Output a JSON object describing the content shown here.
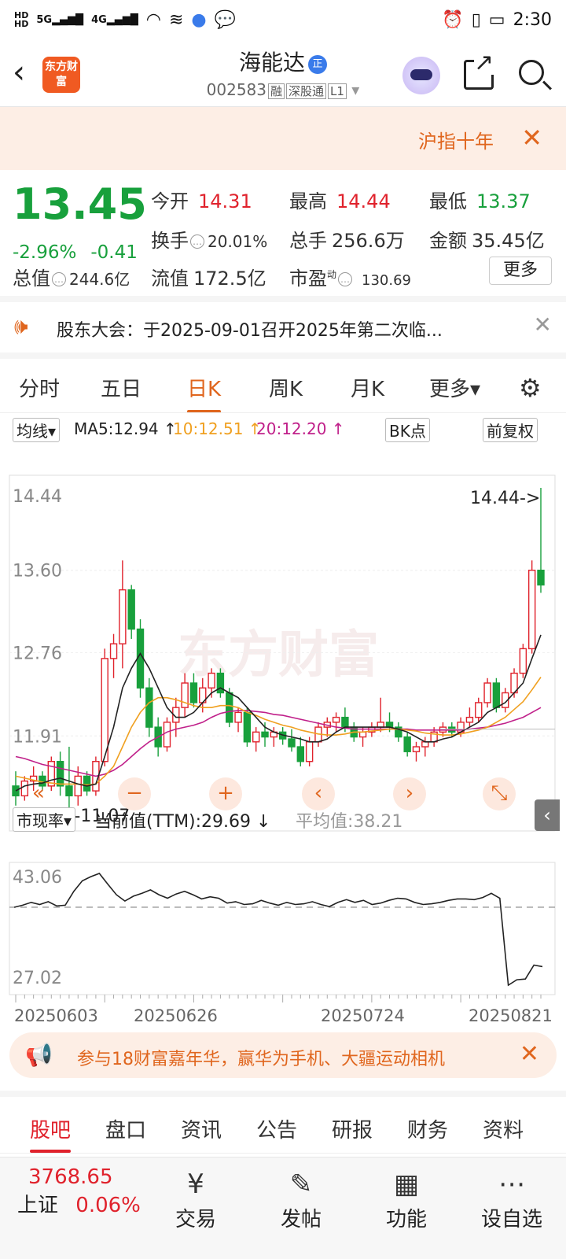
{
  "status": {
    "left_icons": [
      "HD1",
      "HD2",
      "5G-signal",
      "4G-signal",
      "wifi",
      "nfc",
      "browser",
      "chat"
    ],
    "signal1": "5G",
    "signal2": "4G",
    "time": "2:30"
  },
  "header": {
    "logo": "东方财富",
    "title": "海能达",
    "title_badge": "正",
    "code": "002583",
    "tags": [
      "融",
      "深股通",
      "L1"
    ]
  },
  "banner": {
    "text": "沪指十年"
  },
  "quote": {
    "price": "13.45",
    "change_pct": "-2.96%",
    "change": "-0.41",
    "open_label": "今开",
    "open": "14.31",
    "high_label": "最高",
    "high": "14.44",
    "low_label": "最低",
    "low": "13.37",
    "turnover_label": "换手",
    "turnover": "20.01%",
    "volume_label": "总手",
    "volume": "256.6万",
    "amount_label": "金额",
    "amount": "35.45亿",
    "mktcap_label": "总值",
    "mktcap": "244.6亿",
    "float_label": "流值",
    "float_cap": "172.5亿",
    "pe_label": "市盈",
    "pe_sup": "动",
    "pe": "130.69",
    "more": "更多"
  },
  "notice": {
    "text": "股东大会：于2025-09-01召开2025年第二次临..."
  },
  "ktabs": [
    "分时",
    "五日",
    "日K",
    "周K",
    "月K",
    "更多"
  ],
  "ktab_active": 2,
  "legend": {
    "ma_select": "均线",
    "ma5": "MA5:12.94 ↑",
    "ma10": "10:12.51 ↑",
    "ma20": "20:12.20 ↑",
    "bs_point": "BK点",
    "adjust": "前复权",
    "colors": {
      "ma5": "#222222",
      "ma10": "#f0a020",
      "ma20": "#c0208a",
      "up": "#e0222c",
      "down": "#18a03c"
    }
  },
  "chart_data": [
    {
      "type": "candlestick",
      "y_ticks": [
        "14.44",
        "13.60",
        "12.76",
        "11.91",
        "11.07"
      ],
      "ylim": [
        11.07,
        14.44
      ],
      "max_label": "14.44->",
      "min_label": "<-11.07",
      "x_ticks": [
        "20250603",
        "20250626",
        "20250724",
        "20250821"
      ],
      "watermark": "东方财富",
      "candles": [
        [
          11.4,
          11.55,
          11.2,
          11.3
        ],
        [
          11.3,
          11.5,
          11.25,
          11.45
        ],
        [
          11.45,
          11.6,
          11.35,
          11.5
        ],
        [
          11.5,
          11.55,
          11.35,
          11.4
        ],
        [
          11.4,
          11.7,
          11.35,
          11.65
        ],
        [
          11.65,
          11.75,
          11.3,
          11.4
        ],
        [
          11.4,
          11.8,
          11.15,
          11.3
        ],
        [
          11.3,
          11.6,
          11.2,
          11.5
        ],
        [
          11.5,
          11.55,
          11.3,
          11.35
        ],
        [
          11.35,
          11.7,
          11.3,
          11.65
        ],
        [
          11.65,
          12.8,
          11.6,
          12.7
        ],
        [
          12.7,
          12.95,
          12.5,
          12.85
        ],
        [
          12.85,
          13.7,
          12.6,
          13.4
        ],
        [
          13.4,
          13.45,
          12.9,
          13.0
        ],
        [
          13.0,
          13.1,
          12.3,
          12.4
        ],
        [
          12.4,
          12.5,
          11.9,
          12.0
        ],
        [
          12.0,
          12.1,
          11.7,
          11.8
        ],
        [
          11.8,
          12.1,
          11.75,
          12.05
        ],
        [
          12.05,
          12.3,
          11.9,
          12.2
        ],
        [
          12.2,
          12.55,
          12.1,
          12.45
        ],
        [
          12.45,
          12.55,
          12.2,
          12.25
        ],
        [
          12.25,
          12.5,
          12.15,
          12.4
        ],
        [
          12.4,
          12.6,
          12.3,
          12.55
        ],
        [
          12.55,
          12.6,
          12.3,
          12.35
        ],
        [
          12.35,
          12.4,
          12.0,
          12.05
        ],
        [
          12.05,
          12.2,
          11.95,
          12.15
        ],
        [
          12.15,
          12.2,
          11.8,
          11.85
        ],
        [
          11.85,
          12.0,
          11.75,
          11.95
        ],
        [
          11.95,
          12.05,
          11.8,
          11.9
        ],
        [
          11.9,
          12.0,
          11.8,
          11.95
        ],
        [
          11.95,
          12.0,
          11.82,
          11.88
        ],
        [
          11.88,
          11.98,
          11.75,
          11.8
        ],
        [
          11.8,
          11.9,
          11.6,
          11.65
        ],
        [
          11.65,
          11.9,
          11.6,
          11.85
        ],
        [
          11.85,
          12.05,
          11.8,
          12.0
        ],
        [
          12.0,
          12.1,
          11.9,
          12.05
        ],
        [
          12.05,
          12.15,
          11.95,
          12.1
        ],
        [
          12.1,
          12.2,
          11.95,
          12.0
        ],
        [
          12.0,
          12.05,
          11.85,
          11.9
        ],
        [
          11.9,
          12.0,
          11.8,
          11.95
        ],
        [
          11.95,
          12.05,
          11.9,
          12.0
        ],
        [
          12.0,
          12.3,
          11.95,
          12.05
        ],
        [
          12.05,
          12.15,
          11.95,
          12.0
        ],
        [
          12.0,
          12.05,
          11.85,
          11.9
        ],
        [
          11.9,
          11.95,
          11.7,
          11.75
        ],
        [
          11.75,
          11.85,
          11.65,
          11.8
        ],
        [
          11.8,
          11.9,
          11.7,
          11.85
        ],
        [
          11.85,
          12.0,
          11.8,
          11.95
        ],
        [
          11.95,
          12.05,
          11.9,
          12.0
        ],
        [
          12.0,
          12.05,
          11.9,
          11.95
        ],
        [
          11.95,
          12.1,
          11.9,
          12.05
        ],
        [
          12.05,
          12.2,
          12.0,
          12.1
        ],
        [
          12.1,
          12.3,
          12.05,
          12.25
        ],
        [
          12.25,
          12.5,
          12.2,
          12.45
        ],
        [
          12.45,
          12.5,
          12.15,
          12.2
        ],
        [
          12.2,
          12.4,
          12.15,
          12.35
        ],
        [
          12.35,
          12.6,
          12.3,
          12.55
        ],
        [
          12.55,
          12.85,
          12.5,
          12.8
        ],
        [
          12.8,
          13.7,
          12.75,
          13.6
        ],
        [
          13.6,
          14.44,
          13.37,
          13.45
        ]
      ],
      "ma5": [
        11.35,
        11.4,
        11.42,
        11.43,
        11.46,
        11.48,
        11.45,
        11.42,
        11.4,
        11.42,
        11.7,
        12.0,
        12.4,
        12.6,
        12.75,
        12.6,
        12.4,
        12.2,
        12.1,
        12.1,
        12.15,
        12.25,
        12.35,
        12.4,
        12.35,
        12.3,
        12.2,
        12.1,
        12.0,
        11.95,
        11.92,
        11.9,
        11.88,
        11.85,
        11.85,
        11.88,
        11.95,
        12.0,
        12.0,
        12.0,
        12.0,
        12.0,
        12.0,
        11.98,
        11.95,
        11.9,
        11.85,
        11.85,
        11.88,
        11.9,
        11.95,
        12.0,
        12.05,
        12.15,
        12.2,
        12.25,
        12.35,
        12.45,
        12.7,
        12.94
      ],
      "ma10": [
        11.5,
        11.48,
        11.46,
        11.44,
        11.43,
        11.42,
        11.42,
        11.42,
        11.41,
        11.42,
        11.5,
        11.6,
        11.8,
        12.0,
        12.15,
        12.25,
        12.3,
        12.3,
        12.28,
        12.25,
        12.22,
        12.2,
        12.2,
        12.22,
        12.22,
        12.2,
        12.15,
        12.12,
        12.08,
        12.05,
        12.02,
        12.0,
        11.97,
        11.95,
        11.93,
        11.92,
        11.92,
        11.93,
        11.95,
        11.95,
        11.96,
        11.97,
        11.98,
        11.98,
        11.97,
        11.96,
        11.94,
        11.93,
        11.92,
        11.92,
        11.93,
        11.95,
        11.97,
        12.0,
        12.05,
        12.1,
        12.18,
        12.26,
        12.38,
        12.51
      ],
      "ma20": [
        11.7,
        11.68,
        11.65,
        11.62,
        11.6,
        11.58,
        11.56,
        11.54,
        11.52,
        11.5,
        11.52,
        11.56,
        11.62,
        11.7,
        11.78,
        11.85,
        11.9,
        11.95,
        11.98,
        12.0,
        12.02,
        12.05,
        12.1,
        12.14,
        12.16,
        12.17,
        12.17,
        12.16,
        12.15,
        12.13,
        12.12,
        12.1,
        12.08,
        12.06,
        12.04,
        12.02,
        12.0,
        11.99,
        11.98,
        11.98,
        11.98,
        11.98,
        11.98,
        11.98,
        11.98,
        11.97,
        11.97,
        11.97,
        11.97,
        11.97,
        11.97,
        11.98,
        11.99,
        12.0,
        12.02,
        12.04,
        12.07,
        12.1,
        12.15,
        12.2
      ]
    },
    {
      "type": "line",
      "name": "市现率",
      "current": "当前值(TTM):29.69 ↓",
      "average": "平均值:38.21",
      "average_value": 38.21,
      "y_ticks": [
        "43.06",
        "27.02"
      ],
      "ylim": [
        27.02,
        43.06
      ],
      "values": [
        38.2,
        38.5,
        38.9,
        38.6,
        39.0,
        38.4,
        38.5,
        40.5,
        42.0,
        42.6,
        43.06,
        41.5,
        40.0,
        39.1,
        39.8,
        40.2,
        40.7,
        40.0,
        39.5,
        40.1,
        40.5,
        40.0,
        39.4,
        39.7,
        39.5,
        38.8,
        39.0,
        38.6,
        38.7,
        39.2,
        38.8,
        38.5,
        38.9,
        38.6,
        38.7,
        39.0,
        38.6,
        38.3,
        38.9,
        39.3,
        38.9,
        39.2,
        38.6,
        38.8,
        39.2,
        39.5,
        39.4,
        38.9,
        38.6,
        38.7,
        38.9,
        39.2,
        39.4,
        39.4,
        39.3,
        39.6,
        40.2,
        39.5,
        27.02,
        27.8,
        27.9,
        29.9,
        29.69
      ]
    }
  ],
  "chart_toolbar": [
    "«",
    "−",
    "+",
    "‹",
    "›",
    "⤡"
  ],
  "pcf_select": "市现率",
  "promo": {
    "text": "参与18财富嘉年华，赢华为手机、大疆运动相机"
  },
  "bottom_tabs": [
    "股吧",
    "盘口",
    "资讯",
    "公告",
    "研报",
    "财务",
    "资料"
  ],
  "bottom_tab_active": 0,
  "bottom_nav": {
    "index_value": "3768.65",
    "index_name": "上证",
    "index_change": "0.06%",
    "items": [
      "交易",
      "发帖",
      "功能",
      "设自选"
    ]
  }
}
